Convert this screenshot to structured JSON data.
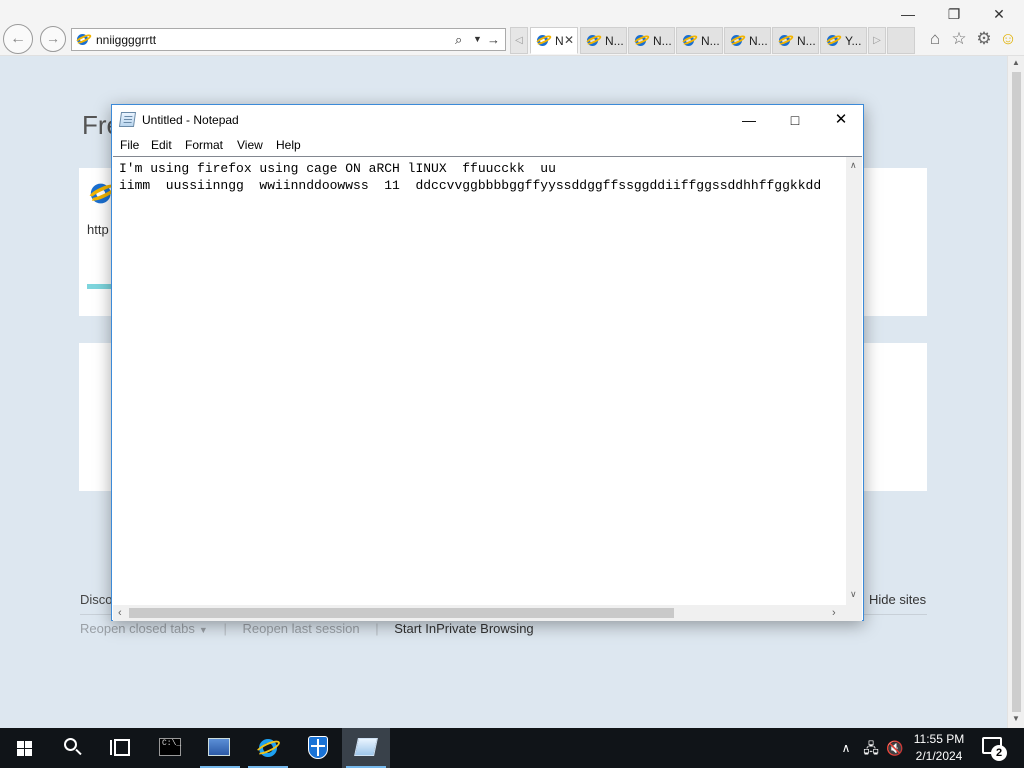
{
  "browser": {
    "address_value": "nniiggggrrtt",
    "tabs": [
      {
        "label": "N",
        "active": true
      },
      {
        "label": "N...",
        "active": false
      },
      {
        "label": "N...",
        "active": false
      },
      {
        "label": "N...",
        "active": false
      },
      {
        "label": "N...",
        "active": false
      },
      {
        "label": "N...",
        "active": false
      },
      {
        "label": "Y...",
        "active": false
      }
    ],
    "new_tab_page": {
      "title_fragment": "Fre",
      "url_fragment": "http",
      "discover_fragment": "Disco",
      "hide_sites": "Hide sites",
      "reopen_closed_tabs": "Reopen closed tabs",
      "reopen_last_session": "Reopen last session",
      "start_inprivate": "Start InPrivate Browsing"
    },
    "icons": {
      "back": "back-arrow-icon",
      "forward": "forward-arrow-icon",
      "search": "search-icon",
      "home": "home-icon",
      "favorites": "star-icon",
      "tools": "gear-icon",
      "feedback": "smiley-icon"
    }
  },
  "notepad": {
    "title": "Untitled - Notepad",
    "menu": {
      "file": "File",
      "edit": "Edit",
      "format": "Format",
      "view": "View",
      "help": "Help"
    },
    "content": "I'm using firefox using cage ON aRCH lINUX  ffuucckk  uu\niimm  uussiinngg  wwiinnddoowwss  11  ddccvvggbbbbggffyyssddggffssggddiiffggssddhhffggkkdd"
  },
  "taskbar": {
    "time": "11:55 PM",
    "date": "2/1/2024",
    "notification_count": "2",
    "accent_color": "#76b9ed"
  }
}
